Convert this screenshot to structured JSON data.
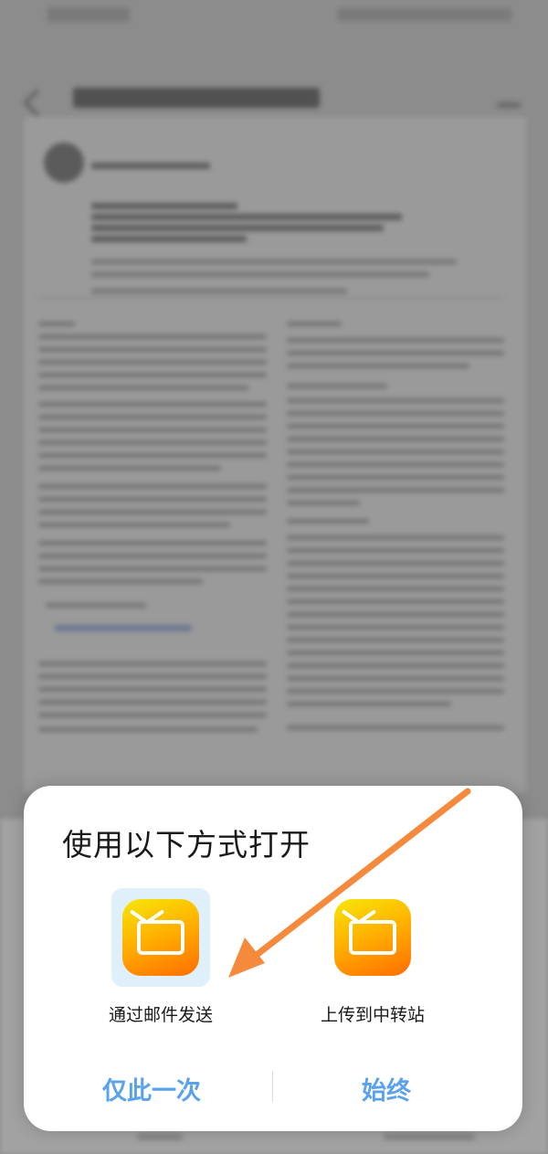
{
  "dialog": {
    "title": "使用以下方式打开",
    "options": [
      {
        "label": "通过邮件发送",
        "icon": "qq-mail-icon"
      },
      {
        "label": "上传到中转站",
        "icon": "qq-mail-icon"
      }
    ],
    "buttons": {
      "once": "仅此一次",
      "always": "始终"
    }
  },
  "colors": {
    "accent": "#5aa2ec",
    "arrow": "#f58a3c",
    "icon_gradient": [
      "#f6e60a",
      "#ffb300",
      "#ff6d00"
    ],
    "selected_highlight": "#dff0fb"
  }
}
